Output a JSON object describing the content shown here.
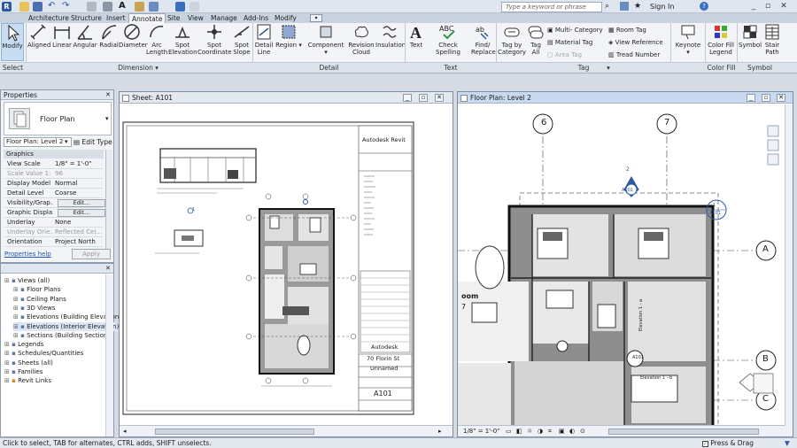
{
  "titlebar": {
    "search_placeholder": "Type a keyword or phrase",
    "signin": "Sign In",
    "help": "?"
  },
  "menu_tabs": [
    "Architecture",
    "Structure",
    "Insert",
    "Annotate",
    "Site",
    "View",
    "Manage",
    "Add-Ins",
    "Modify"
  ],
  "active_tab": "Annotate",
  "ribbon": {
    "modify": "Modify",
    "dimension": [
      "Aligned",
      "Linear",
      "Angular",
      "Radial",
      "Diameter",
      "Arc Length",
      "Spot Elevation",
      "Spot Coordinate",
      "Spot Slope"
    ],
    "detail": [
      "Detail Line",
      "Region",
      "Component",
      "Revision Cloud",
      "Insulation"
    ],
    "text": [
      "Text",
      "Check Spelling",
      "Find/ Replace"
    ],
    "tag_big": [
      "Tag by Category",
      "Tag All"
    ],
    "tag_small": [
      "Multi- Category",
      "Material Tag",
      "Area Tag",
      "Room Tag",
      "View Reference",
      "Tread Number"
    ],
    "keynote": "Keynote",
    "colorfill": "Color Fill Legend",
    "symbol": [
      "Symbol",
      "Stair Path"
    ],
    "panels": [
      "Select",
      "Dimension",
      "Detail",
      "Text",
      "Tag",
      "Color Fill",
      "Symbol"
    ]
  },
  "properties": {
    "title": "Properties",
    "type_name": "Floor Plan",
    "selector": "Floor Plan: Level 2",
    "edit_type": "Edit Type",
    "group": "Graphics",
    "rows": [
      {
        "k": "View Scale",
        "v": "1/8\" = 1'-0\""
      },
      {
        "k": "Scale Value    1:",
        "v": "96",
        "dim": true
      },
      {
        "k": "Display Model",
        "v": "Normal"
      },
      {
        "k": "Detail Level",
        "v": "Coarse"
      },
      {
        "k": "Visibility/Grap...",
        "v": "Edit...",
        "btn": true
      },
      {
        "k": "Graphic Displa...",
        "v": "Edit...",
        "btn": true
      },
      {
        "k": "Underlay",
        "v": "None"
      },
      {
        "k": "Underlay Orie...",
        "v": "Reflected Cei...",
        "dim": true
      },
      {
        "k": "Orientation",
        "v": "Project North"
      }
    ],
    "help": "Properties help",
    "apply": "Apply"
  },
  "browser": {
    "items": [
      {
        "label": "Views (all)",
        "level": 0
      },
      {
        "label": "Floor Plans",
        "level": 1
      },
      {
        "label": "Ceiling Plans",
        "level": 1
      },
      {
        "label": "3D Views",
        "level": 1
      },
      {
        "label": "Elevations (Building Elevation)",
        "level": 1
      },
      {
        "label": "Elevations (Interior Elevation)",
        "level": 1,
        "selected": true
      },
      {
        "label": "Sections (Building Section)",
        "level": 1
      },
      {
        "label": "Legends",
        "level": 0
      },
      {
        "label": "Schedules/Quantities",
        "level": 0
      },
      {
        "label": "Sheets (all)",
        "level": 0
      },
      {
        "label": "Families",
        "level": 0
      },
      {
        "label": "Revit Links",
        "level": 0
      }
    ]
  },
  "sheet_view": {
    "title": "Sheet: A101",
    "titleblock": {
      "app": "Autodesk Revit",
      "company": "Autodesk",
      "address": "70 Florin St",
      "name": "Unnamed",
      "number": "A101"
    },
    "markers": {
      "section": "1",
      "sheet": "A101"
    }
  },
  "plan_view": {
    "title": "Floor Plan: Level 2",
    "grids": [
      "6",
      "7",
      "A",
      "B",
      "C"
    ],
    "tags": {
      "sheet_ref": "A101",
      "elev_num": "1",
      "elev_tag": "2",
      "label1": "Elevation 1 - a",
      "label2": "Elevation 1 - b",
      "room": "oom",
      "room_num": "7"
    },
    "scale": "1/8\" = 1'-0\""
  },
  "status": {
    "hint": "Click to select, TAB for alternates, CTRL adds, SHIFT unselects.",
    "press_drag": "Press & Drag"
  }
}
